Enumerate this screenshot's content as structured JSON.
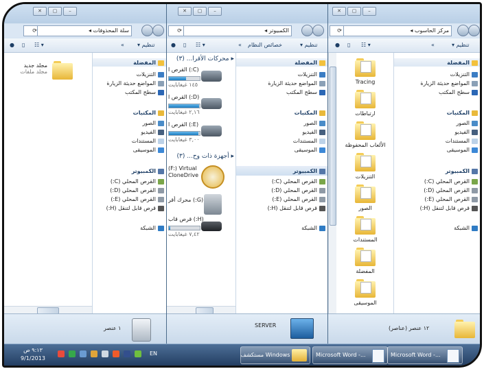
{
  "left_window": {
    "address": "سلة المحذوفات",
    "toolbar_organize": "تنظيم",
    "nav": {
      "favorites": "المفضلة",
      "downloads": "التنزيلات",
      "recent": "المواضع حديثة الزيارة",
      "desktop": "سطح المكتب",
      "libraries": "المكتبات",
      "pictures": "الصور",
      "videos": "الفيديو",
      "documents": "المستندات",
      "music": "الموسيقى",
      "computer": "الكمبيوتر",
      "drive_c": "القرص المحلي (C:)",
      "drive_d": "القرص المحلي (D:)",
      "drive_e": "القرص المحلي (E:)",
      "drive_h": "قرص قابل لتنقل (H:)",
      "network": "الشبكة"
    },
    "content": {
      "folder_name": "مجلد جديد",
      "folder_sub": "مجلد ملفات"
    },
    "status_text": "١ عنصر"
  },
  "mid_window": {
    "address_root": "الكمبيوتر",
    "toolbar_organize": "تنظيم",
    "toolbar_properties": "خصائص النظام",
    "nav": {
      "favorites": "المفضلة",
      "downloads": "التنزيلات",
      "recent": "المواضع حديثة الزيارة",
      "desktop": "سطح المكتب",
      "libraries": "المكتبات",
      "pictures": "الصور",
      "videos": "الفيديو",
      "documents": "المستندات",
      "music": "الموسيقى",
      "computer": "الكمبيوتر",
      "drive_c": "القرص المحلي (C:)",
      "drive_d": "القرص المحلي (D:)",
      "drive_e": "القرص المحلي (E:)",
      "drive_h": "قرص قابل لتنقل (H:)",
      "network": "الشبكة"
    },
    "content": {
      "hdd_group": "محركات الأقرا... (٣)",
      "removable_group": "أجهزة ذات وح... (٣)",
      "drives": [
        {
          "name": "(C:) القرص ا",
          "free": "١٤٥ غيغابايت",
          "used_fraction": 0.55
        },
        {
          "name": "(D:) القرص ا",
          "free": "٢,١٦ غيغابايت",
          "used_fraction": 0.97
        },
        {
          "name": "(E:) القرص ا",
          "free": "٣,٠٠ غيغابايت",
          "used_fraction": 0.95
        }
      ],
      "virtual_drive_line1": "(F:) Virtual",
      "virtual_drive_line2": "CloneDrive",
      "dvd_drive": "(G:) محرك أقر",
      "removable_name": "(H:) قرص قاب",
      "removable_free": "٧,٤٢ غيغابايت",
      "removable_used_fraction": 0.05
    },
    "status_text": "SERVER"
  },
  "right_window": {
    "address_root": "مركز الحاسوب",
    "toolbar_organize": "تنظيم",
    "nav": {
      "favorites": "المفضلة",
      "downloads": "التنزيلات",
      "recent": "المواضع حديثة الزيارة",
      "desktop": "سطح المكتب",
      "libraries": "المكتبات",
      "pictures": "الصور",
      "videos": "الفيديو",
      "documents": "المستندات",
      "music": "الموسيقى",
      "computer": "الكمبيوتر",
      "drive_c": "القرص المحلي (C:)",
      "drive_d": "القرص المحلي (D:)",
      "drive_e": "القرص المحلي (E:)",
      "drive_h": "قرص قابل لتنقل (H:)",
      "network": "الشبكة"
    },
    "content": {
      "items": [
        "Tracing",
        "ارتباطات",
        "الألعاب المحفوظة",
        "التنزيلات",
        "الصور",
        "المستندات",
        "المفضلة",
        "الموسيقى"
      ]
    },
    "status_text": "١٢ عنصر (عناصر)"
  },
  "taskbar": {
    "time": "٩:١٣ ص",
    "date": "9/1/2013",
    "lang": "EN",
    "windows_task": "Windows مستكشف",
    "word_task_1": "Microsoft Word -...",
    "word_task_2": "Microsoft Word -..."
  },
  "colors": {
    "accent": "#2d6aa3",
    "title_bar": "#c2d6ec",
    "taskbar": "#2a4a72"
  }
}
